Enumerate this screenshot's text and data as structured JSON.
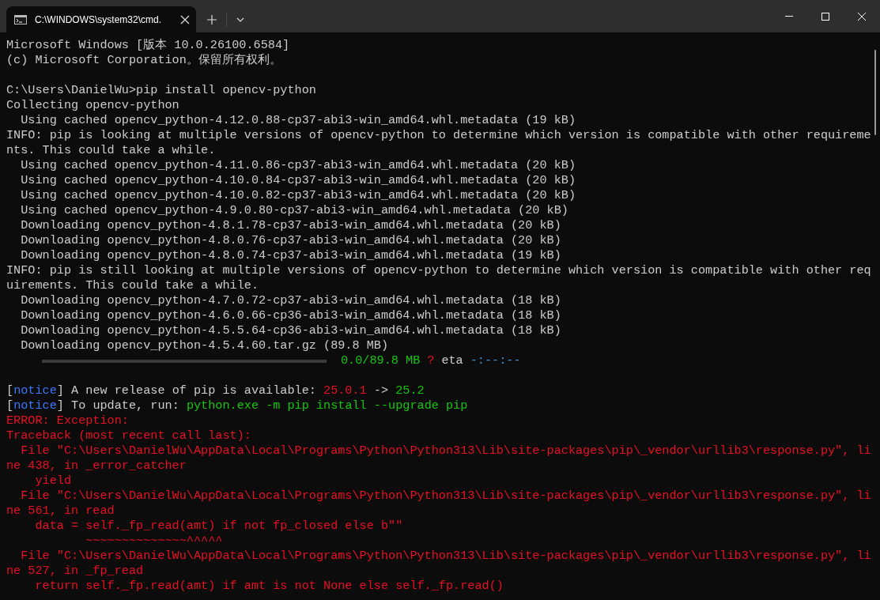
{
  "tab": {
    "title": "C:\\WINDOWS\\system32\\cmd.",
    "selected": true
  },
  "lines": [
    {
      "segments": [
        {
          "kind": "plain",
          "text": "Microsoft Windows [版本 10.0.26100.6584]"
        }
      ]
    },
    {
      "segments": [
        {
          "kind": "plain",
          "text": "(c) Microsoft Corporation。保留所有权利。"
        }
      ]
    },
    {
      "blank_line_before": true,
      "segments": [
        {
          "kind": "plain",
          "text": "C:\\Users\\DanielWu>pip install opencv-python"
        }
      ]
    },
    {
      "segments": [
        {
          "kind": "plain",
          "text": "Collecting opencv-python"
        }
      ]
    },
    {
      "segments": [
        {
          "kind": "plain",
          "text": "  Using cached opencv_python-4.12.0.88-cp37-abi3-win_amd64.whl.metadata (19 kB)"
        }
      ]
    },
    {
      "segments": [
        {
          "kind": "plain",
          "text": "INFO: pip is looking at multiple versions of opencv-python to determine which version is compatible with other requireme"
        }
      ]
    },
    {
      "segments": [
        {
          "kind": "plain",
          "text": "nts. This could take a while."
        }
      ]
    },
    {
      "segments": [
        {
          "kind": "plain",
          "text": "  Using cached opencv_python-4.11.0.86-cp37-abi3-win_amd64.whl.metadata (20 kB)"
        }
      ]
    },
    {
      "segments": [
        {
          "kind": "plain",
          "text": "  Using cached opencv_python-4.10.0.84-cp37-abi3-win_amd64.whl.metadata (20 kB)"
        }
      ]
    },
    {
      "segments": [
        {
          "kind": "plain",
          "text": "  Using cached opencv_python-4.10.0.82-cp37-abi3-win_amd64.whl.metadata (20 kB)"
        }
      ]
    },
    {
      "segments": [
        {
          "kind": "plain",
          "text": "  Using cached opencv_python-4.9.0.80-cp37-abi3-win_amd64.whl.metadata (20 kB)"
        }
      ]
    },
    {
      "segments": [
        {
          "kind": "plain",
          "text": "  Downloading opencv_python-4.8.1.78-cp37-abi3-win_amd64.whl.metadata (20 kB)"
        }
      ]
    },
    {
      "segments": [
        {
          "kind": "plain",
          "text": "  Downloading opencv_python-4.8.0.76-cp37-abi3-win_amd64.whl.metadata (20 kB)"
        }
      ]
    },
    {
      "segments": [
        {
          "kind": "plain",
          "text": "  Downloading opencv_python-4.8.0.74-cp37-abi3-win_amd64.whl.metadata (19 kB)"
        }
      ]
    },
    {
      "segments": [
        {
          "kind": "plain",
          "text": "INFO: pip is still looking at multiple versions of opencv-python to determine which version is compatible with other req"
        }
      ]
    },
    {
      "segments": [
        {
          "kind": "plain",
          "text": "uirements. This could take a while."
        }
      ]
    },
    {
      "segments": [
        {
          "kind": "plain",
          "text": "  Downloading opencv_python-4.7.0.72-cp37-abi3-win_amd64.whl.metadata (18 kB)"
        }
      ]
    },
    {
      "segments": [
        {
          "kind": "plain",
          "text": "  Downloading opencv_python-4.6.0.66-cp36-abi3-win_amd64.whl.metadata (18 kB)"
        }
      ]
    },
    {
      "segments": [
        {
          "kind": "plain",
          "text": "  Downloading opencv_python-4.5.5.64-cp36-abi3-win_amd64.whl.metadata (18 kB)"
        }
      ]
    },
    {
      "segments": [
        {
          "kind": "plain",
          "text": "  Downloading opencv_python-4.5.4.60.tar.gz (89.8 MB)"
        }
      ]
    },
    {
      "segments": [
        {
          "kind": "bar",
          "level": 0
        },
        {
          "kind": "green",
          "text": "0.0/89.8 MB"
        },
        {
          "kind": "red",
          "text": "?"
        },
        {
          "kind": "plain",
          "text": "eta"
        },
        {
          "kind": "cyan",
          "text": "-:--:--"
        }
      ]
    },
    {
      "blank_line_before": true,
      "segments": [
        {
          "kind": "plain",
          "text": "["
        },
        {
          "kind": "blue",
          "text": "notice"
        },
        {
          "kind": "plain",
          "text": "] A new release of pip is available: "
        },
        {
          "kind": "red",
          "text": "25.0.1"
        },
        {
          "kind": "plain",
          "text": " -> "
        },
        {
          "kind": "green",
          "text": "25.2"
        }
      ]
    },
    {
      "segments": [
        {
          "kind": "plain",
          "text": "["
        },
        {
          "kind": "blue",
          "text": "notice"
        },
        {
          "kind": "plain",
          "text": "] To update, run: "
        },
        {
          "kind": "green",
          "text": "python.exe -m pip install --upgrade pip"
        }
      ]
    },
    {
      "segments": [
        {
          "kind": "red",
          "text": "ERROR: Exception:"
        }
      ]
    },
    {
      "segments": [
        {
          "kind": "red",
          "text": "Traceback (most recent call last):"
        }
      ]
    },
    {
      "segments": [
        {
          "kind": "red",
          "text": "  File \"C:\\Users\\DanielWu\\AppData\\Local\\Programs\\Python\\Python313\\Lib\\site-packages\\pip\\_vendor\\urllib3\\response.py\", li"
        }
      ]
    },
    {
      "segments": [
        {
          "kind": "red",
          "text": "ne 438, in _error_catcher"
        }
      ]
    },
    {
      "segments": [
        {
          "kind": "red",
          "text": "    yield"
        }
      ]
    },
    {
      "segments": [
        {
          "kind": "red",
          "text": "  File \"C:\\Users\\DanielWu\\AppData\\Local\\Programs\\Python\\Python313\\Lib\\site-packages\\pip\\_vendor\\urllib3\\response.py\", li"
        }
      ]
    },
    {
      "segments": [
        {
          "kind": "red",
          "text": "ne 561, in read"
        }
      ]
    },
    {
      "segments": [
        {
          "kind": "red",
          "text": "    data = self._fp_read(amt) if not fp_closed else b\"\""
        }
      ]
    },
    {
      "segments": [
        {
          "kind": "red",
          "text": "           ~~~~~~~~~~~~~~^^^^^"
        }
      ]
    },
    {
      "segments": [
        {
          "kind": "red",
          "text": "  File \"C:\\Users\\DanielWu\\AppData\\Local\\Programs\\Python\\Python313\\Lib\\site-packages\\pip\\_vendor\\urllib3\\response.py\", li"
        }
      ]
    },
    {
      "segments": [
        {
          "kind": "red",
          "text": "ne 527, in _fp_read"
        }
      ]
    },
    {
      "segments": [
        {
          "kind": "red",
          "text": "    return self._fp.read(amt) if amt is not None else self._fp.read()"
        }
      ]
    }
  ]
}
